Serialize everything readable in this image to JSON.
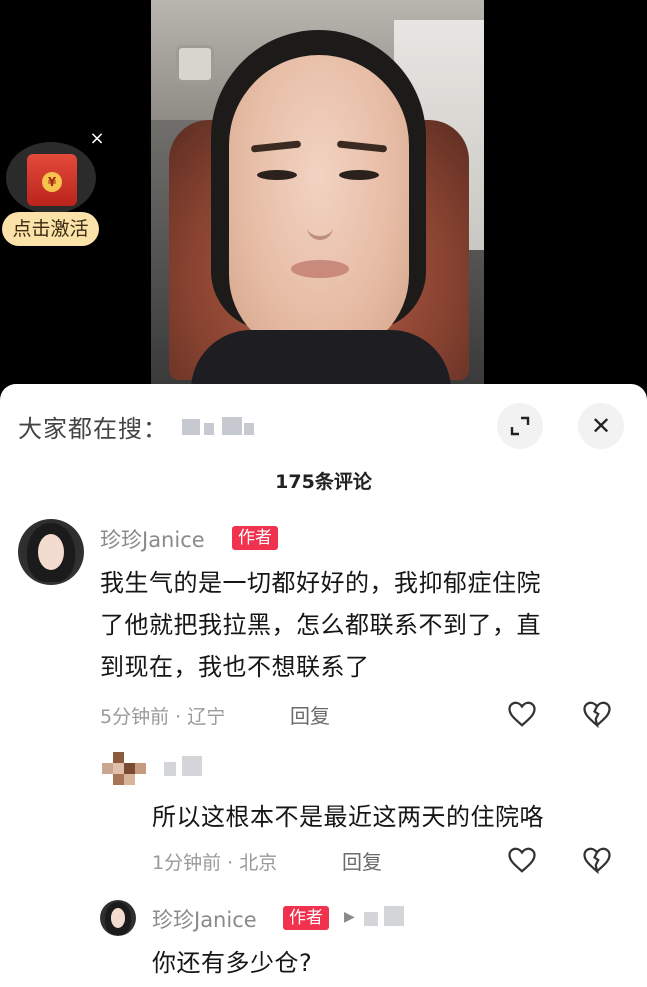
{
  "red_packet": {
    "activate_label": "点击激活",
    "close_symbol": "×",
    "coin_symbol": "¥"
  },
  "panel": {
    "search_label": "大家都在搜：",
    "comment_count": "175条评论",
    "close_symbol": "✕"
  },
  "comments": [
    {
      "username": "珍珍Janice",
      "author_tag": "作者",
      "text": [
        "我生气的是一切都好好的，我抑郁症住院",
        "了他就把我拉黑，怎么都联系不到了，直",
        "到现在，我也不想联系了"
      ],
      "time_location": "5分钟前 · 辽宁",
      "reply_label": "回复"
    },
    {
      "username": "",
      "text": "所以这根本不是最近这两天的住院咯",
      "time_location": "1分钟前 · 北京",
      "reply_label": "回复"
    },
    {
      "username": "珍珍Janice",
      "author_tag": "作者",
      "reply_arrow": "▶",
      "text": "你还有多少仓?"
    }
  ],
  "icons": {
    "like": "heart-icon",
    "dislike": "broken-heart-icon",
    "expand": "expand-icon",
    "close": "close-icon"
  }
}
